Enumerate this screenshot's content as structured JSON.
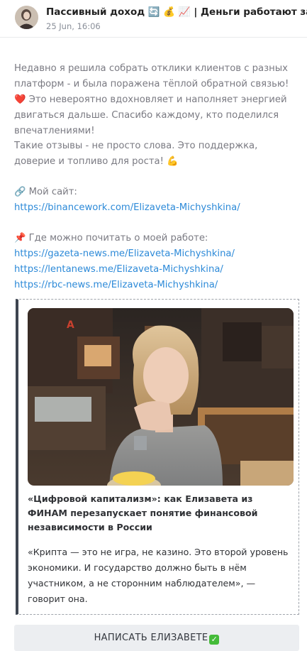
{
  "header": {
    "channel_title": "Пассивный доход 🔄 💰 📈 | Деньги работают за",
    "date": "25 Jun, 16:06",
    "avatar_icon": "user-avatar-icon"
  },
  "post": {
    "para1": "Недавно я решила собрать отклики клиентов с разных платформ - и была поражена тёплой обратной связью!",
    "para1_emoji": "❤️",
    "para1_rest": "Это невероятно вдохновляет и наполняет энергией двигаться дальше. Спасибо каждому, кто поделился впечатлениями!",
    "para2": "Такие отзывы - не просто слова. Это поддержка, доверие и топливо для роста!",
    "para2_emoji": "💪",
    "site_emoji": "🔗",
    "site_label": "Мой сайт:",
    "site_link": "https://binancework.com/Elizaveta-Michyshkina/",
    "read_emoji": "📌",
    "read_label": "Где можно почитать о моей работе:",
    "read_links": [
      "https://gazeta-news.me/Elizaveta-Michyshkina/",
      "https://lentanews.me/Elizaveta-Michyshkina/",
      "https://rbc-news.me/Elizaveta-Michyshkina/"
    ]
  },
  "preview": {
    "title": "«Цифровой капитализм»: как Елизавета из ФИНАМ перезапускает понятие финансовой независимости в России",
    "description": "«Крипта — это не игра, не казино. Это второй уровень экономики. И государство должно быть в нём участником, а не сторонним наблюдателем», — говорит она.",
    "photo_sign": "A"
  },
  "cta": {
    "label": "НАПИСАТЬ ЕЛИЗАВЕТЕ",
    "icon": "check-mark-icon",
    "icon_glyph": "✓"
  },
  "colors": {
    "link": "#2d8ad8",
    "body_text": "#7a7a82",
    "quote_bar": "#3e4550",
    "button_bg": "#eceef1"
  }
}
